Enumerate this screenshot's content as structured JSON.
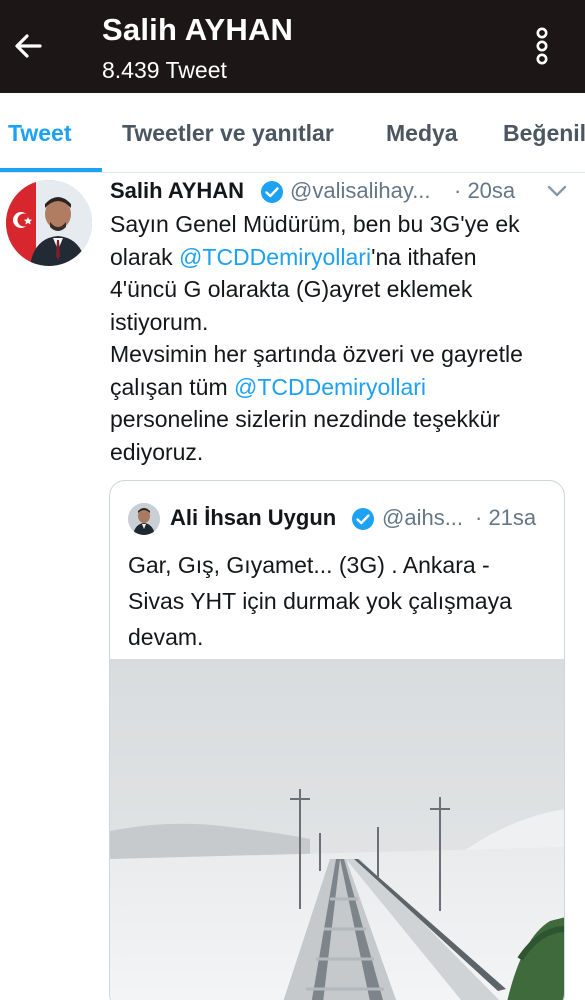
{
  "header": {
    "back_icon": "arrow-left-icon",
    "title": "Salih AYHAN",
    "subtitle": "8.439 Tweet",
    "menu_icon": "more-vertical-icon",
    "background": "#1c1716"
  },
  "tabs": [
    {
      "label": "Tweet",
      "active": true
    },
    {
      "label": "Tweetler ve yanıtlar",
      "active": false
    },
    {
      "label": "Medya",
      "active": false
    },
    {
      "label": "Beğenil",
      "active": false
    }
  ],
  "accent_color": "#1da1f2",
  "tweet": {
    "author": "Salih AYHAN",
    "verified_icon": "verified-badge-icon",
    "handle": "@valisalihay...",
    "time": "· 20sa",
    "caret_icon": "chevron-down-icon",
    "lines": [
      {
        "pre": "Sayın Genel Müdürüm, ben bu 3G'ye ek",
        "mention": "",
        "post": ""
      },
      {
        "pre": "olarak ",
        "mention": "@TCDDemiryollari",
        "post": "'na ithafen"
      },
      {
        "pre": "4'üncü G olarakta (G)ayret eklemek",
        "mention": "",
        "post": ""
      },
      {
        "pre": "istiyorum.",
        "mention": "",
        "post": ""
      },
      {
        "pre": "Mevsimin her şartında özveri ve gayretle",
        "mention": "",
        "post": ""
      },
      {
        "pre": "çalışan tüm ",
        "mention": "@TCDDemiryollari",
        "post": ""
      },
      {
        "pre": "personeline sizlerin nezdinde teşekkür",
        "mention": "",
        "post": ""
      },
      {
        "pre": "ediyoruz.",
        "mention": "",
        "post": ""
      }
    ],
    "quoted": {
      "author": "Ali İhsan Uygun",
      "verified_icon": "verified-badge-icon",
      "handle": "@aihs...",
      "time": "· 21sa",
      "lines": [
        "Gar, Gış, Gıyamet... (3G) . Ankara -",
        "Sivas YHT için durmak yok çalışmaya",
        "devam."
      ],
      "media_description": "snowy-railway-photo"
    }
  }
}
